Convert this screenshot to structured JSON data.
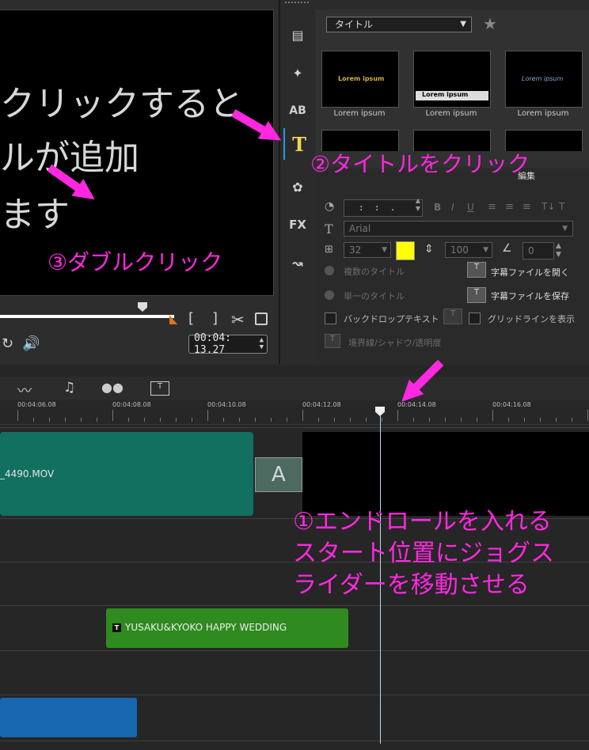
{
  "preview": {
    "text_line1": "クリックすると",
    "text_line2": "ルが追加",
    "text_line3": "ます",
    "timecode": "00:04: 13.27"
  },
  "library": {
    "dropdown_selected": "タイトル",
    "thumbnails": [
      {
        "label": "Lorem ipsum",
        "overlay": "Lorem ipsum"
      },
      {
        "label": "Lorem ipsum",
        "overlay": "Lorem ipsum"
      },
      {
        "label": "Lorem ipsum",
        "overlay": "Lorem ipsum"
      }
    ],
    "tabs": [
      "media-icon",
      "instant-project-icon",
      "transition-icon",
      "title-icon",
      "graphic-icon",
      "filter-icon",
      "path-icon"
    ],
    "fx_label": "FX",
    "ab_label": "AB"
  },
  "edit": {
    "tab_label": "編集",
    "font": "Arial",
    "font_size": "32",
    "line_spacing": "100",
    "rotation": "0",
    "font_color": "#ffff00",
    "multi_title": "複数のタイトル",
    "single_title": "単一のタイトル",
    "backdrop": "バックドロップテキスト",
    "open_subtitle": "字幕ファイルを開く",
    "save_subtitle": "字幕ファイルを保存",
    "gridlines": "グリッドラインを表示",
    "border_shadow": "境界線/シャドウ/透明度"
  },
  "timeline": {
    "ruler_labels": [
      "00:04:06.08",
      "00:04:08.08",
      "00:04:10.08",
      "00:04:12.08",
      "00:04:14.08",
      "00:04:16.08"
    ],
    "video_clip": "_4490.MOV",
    "title_clip": "YUSAKU&KYOKO HAPPY WEDDING"
  },
  "annotations": {
    "step1_line1": "①エンドロールを入れる",
    "step1_line2": "スタート位置にジョグス",
    "step1_line3": "ライダーを移動させる",
    "step2": "②タイトルをクリック",
    "step3": "③ダブルクリック"
  },
  "colors": {
    "annotation": "#ff28e0",
    "video_clip": "#127060",
    "title_clip": "#2f8a1f",
    "overlay_clip": "#1766b0"
  }
}
